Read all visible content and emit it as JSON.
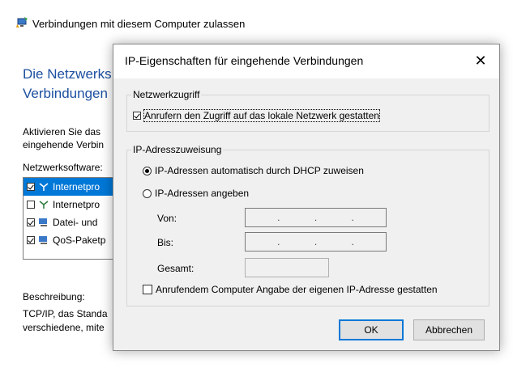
{
  "background": {
    "title": "Verbindungen mit diesem Computer zulassen",
    "heading_line1": "Die Netzwerks",
    "heading_line2": "Verbindungen",
    "desc_line1": "Aktivieren Sie das",
    "desc_line2": "eingehende Verbin",
    "software_label": "Netzwerksoftware:",
    "software_items": [
      {
        "label": "Internetpro",
        "checked": true,
        "selected": true
      },
      {
        "label": "Internetpro",
        "checked": false,
        "selected": false
      },
      {
        "label": "Datei- und",
        "checked": true,
        "selected": false
      },
      {
        "label": "QoS-Paketp",
        "checked": true,
        "selected": false
      }
    ],
    "beschreibung_label": "Beschreibung:",
    "beschreibung_line1": "TCP/IP, das Standa",
    "beschreibung_line2": "verschiedene, mite"
  },
  "dialog": {
    "title": "IP-Eigenschaften für eingehende Verbindungen",
    "close_glyph": "✕",
    "netzwerkzugriff_legend": "Netzwerkzugriff",
    "allow_lan_label": "Anrufern den Zugriff auf das lokale Netzwerk gestatten",
    "allow_lan_checked": true,
    "ip_legend": "IP-Adresszuweisung",
    "dhcp_label": "IP-Adressen automatisch durch DHCP zuweisen",
    "dhcp_selected": true,
    "specify_label": "IP-Adressen angeben",
    "von_label": "Von:",
    "bis_label": "Bis:",
    "gesamt_label": "Gesamt:",
    "ip_dot": ".",
    "caller_ip_label": "Anrufendem Computer Angabe der eigenen IP-Adresse gestatten",
    "caller_ip_checked": false,
    "ok_label": "OK",
    "cancel_label": "Abbrechen"
  },
  "colors": {
    "accent": "#0078d7",
    "heading": "#1c4fa0",
    "dialog_bg": "#f0f0f0"
  }
}
